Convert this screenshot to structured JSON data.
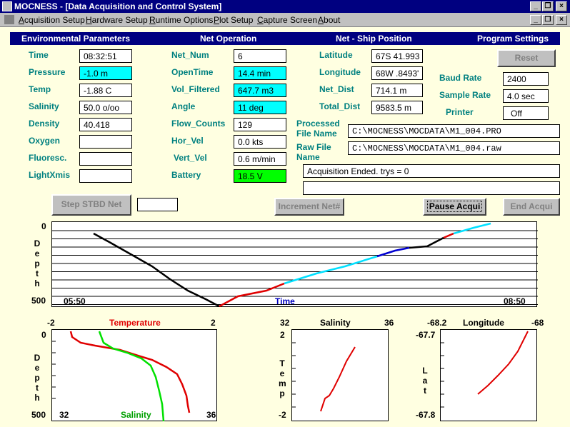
{
  "window": {
    "title": "MOCNESS - [Data Acquisition and Control System]"
  },
  "menu": [
    "Acquisition Setup",
    "Hardware Setup",
    "Runtime Options",
    "Plot Setup",
    "Capture Screen",
    "About"
  ],
  "headers": {
    "env": "Environmental Parameters",
    "net": "Net Operation",
    "pos": "Net - Ship Position",
    "prog": "Program Settings"
  },
  "env": {
    "time_label": "Time",
    "time": "08:32:51",
    "pressure_label": "Pressure",
    "pressure": "-1.0 m",
    "temp_label": "Temp",
    "temp": "-1.88 C",
    "salinity_label": "Salinity",
    "salinity": "50.0 o/oo",
    "density_label": "Density",
    "density": "40.418",
    "oxygen_label": "Oxygen",
    "oxygen": "",
    "fluoresc_label": "Fluoresc.",
    "fluoresc": "",
    "lightxmis_label": "LightXmis",
    "lightxmis": ""
  },
  "net": {
    "num_label": "Net_Num",
    "num": "6",
    "opentime_label": "OpenTime",
    "opentime": "14.4 min",
    "volf_label": "Vol_Filtered",
    "volf": "647.7 m3",
    "angle_label": "Angle",
    "angle": "11 deg",
    "flow_label": "Flow_Counts",
    "flow": "129",
    "horvel_label": "Hor_Vel",
    "horvel": "0.0 kts",
    "vertvel_label": "Vert_Vel",
    "vertvel": "0.6 m/min",
    "battery_label": "Battery",
    "battery": "18.5 V"
  },
  "pos": {
    "lat_label": "Latitude",
    "lat": "67S 41.993",
    "lon_label": "Longitude",
    "lon": "68W .8493'",
    "netdist_label": "Net_Dist",
    "netdist": "714.1 m",
    "totdist_label": "Total_Dist",
    "totdist": "9583.5 m"
  },
  "prog": {
    "reset": "Reset",
    "baud_label": "Baud Rate",
    "baud": "2400",
    "sample_label": "Sample Rate",
    "sample": "4.0 sec",
    "printer_label": "Printer",
    "printer": "Off"
  },
  "files": {
    "processed_label": "Processed File Name",
    "processed": "C:\\MOCNESS\\MOCDATA\\M1_004.PRO",
    "raw_label": "Raw File Name",
    "raw": "C:\\MOCNESS\\MOCDATA\\M1_004.raw"
  },
  "status": {
    "message": "Acquisition Ended. trys = 0",
    "message2": ""
  },
  "buttons": {
    "step": "Step STBD Net",
    "step_value": "",
    "increment": "Increment Net#",
    "pause": "Pause Acqui",
    "end": "End Acqui"
  },
  "depth_plot": {
    "ylabel": "Depth",
    "y_top": "0",
    "y_bottom": "500",
    "x_left": "05:50",
    "x_right": "08:50",
    "xlabel": "Time"
  },
  "temp_plot": {
    "top_left": "-2",
    "top_label": "Temperature",
    "top_right": "2",
    "ylabel": "Depth",
    "y_top": "0",
    "y_bottom": "500",
    "bottom_left": "32",
    "bottom_label": "Salinity",
    "bottom_right": "36"
  },
  "sal_plot": {
    "x_left": "32",
    "xlabel": "Salinity",
    "x_right": "36",
    "ylabel": "Temp",
    "y_top": "2",
    "y_bottom": "-2"
  },
  "lon_plot": {
    "x_left": "-68.2",
    "xlabel": "Longitude",
    "x_right": "-68",
    "ylabel": "Lat",
    "y_top": "-67.7",
    "y_bottom": "-67.8"
  },
  "colors": {
    "titlebar": "#000080",
    "background": "#FFFFE1",
    "label": "#008080",
    "highlight": "#00FFFF",
    "ok": "#00FF00"
  }
}
